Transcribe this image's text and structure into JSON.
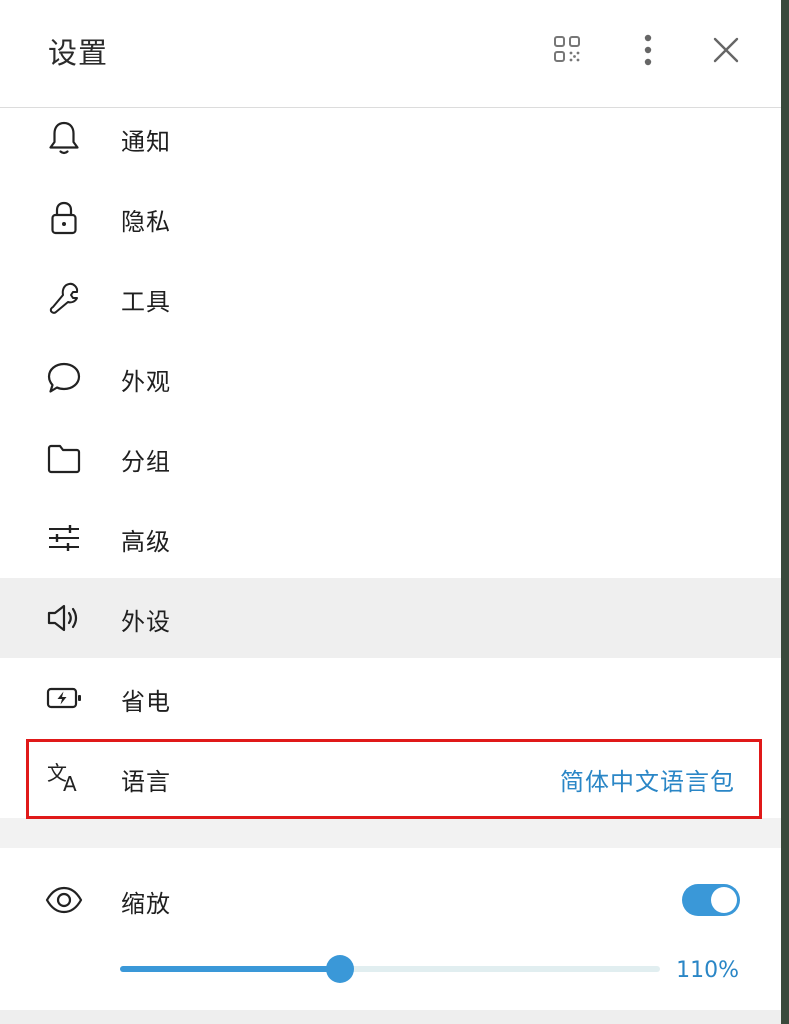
{
  "header": {
    "title": "设置",
    "icons": [
      "qr-code-icon",
      "more-vertical-icon",
      "close-icon"
    ]
  },
  "settings": {
    "items": [
      {
        "label": "通知",
        "icon": "bell-icon"
      },
      {
        "label": "隐私",
        "icon": "lock-icon"
      },
      {
        "label": "工具",
        "icon": "wrench-icon"
      },
      {
        "label": "外观",
        "icon": "speech-bubble-icon"
      },
      {
        "label": "分组",
        "icon": "folder-icon"
      },
      {
        "label": "高级",
        "icon": "sliders-icon"
      },
      {
        "label": "外设",
        "icon": "speaker-icon",
        "selected": true
      },
      {
        "label": "省电",
        "icon": "battery-charging-icon"
      },
      {
        "label": "语言",
        "icon": "translate-icon",
        "value": "简体中文语言包",
        "highlighted": true
      }
    ]
  },
  "zoom": {
    "label": "缩放",
    "icon": "eye-icon",
    "enabled": true,
    "value_text": "110%",
    "slider_fraction": 0.408
  },
  "colors": {
    "accent": "#3a98d8",
    "value_text": "#2a86c6",
    "highlight_border": "#e01919",
    "selected_row": "#efefef"
  }
}
